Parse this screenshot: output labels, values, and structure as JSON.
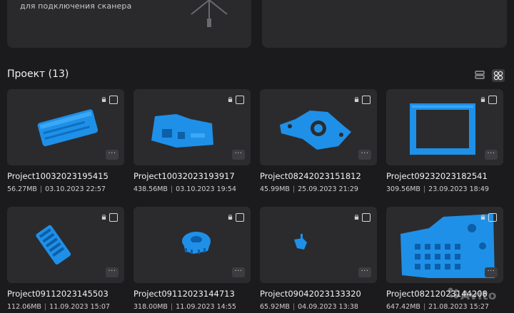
{
  "top": {
    "connect_hint": "для подключения сканера"
  },
  "section": {
    "title": "Проект (13)"
  },
  "view_toggle": {
    "list_icon": "list-view-icon",
    "grid_icon": "grid-view-icon"
  },
  "accent_color": "#1e90e8",
  "projects": [
    {
      "name": "Project10032023195415",
      "size": "56.27MB",
      "date": "03.10.2023 22:57"
    },
    {
      "name": "Project10032023193917",
      "size": "438.56MB",
      "date": "03.10.2023 19:54"
    },
    {
      "name": "Project08242023151812",
      "size": "45.99MB",
      "date": "25.09.2023 21:29"
    },
    {
      "name": "Project09232023182541",
      "size": "309.56MB",
      "date": "23.09.2023 18:49"
    },
    {
      "name": "Project09112023145503",
      "size": "112.06MB",
      "date": "11.09.2023 15:07"
    },
    {
      "name": "Project09112023144713",
      "size": "318.00MB",
      "date": "11.09.2023 14:55"
    },
    {
      "name": "Project09042023133320",
      "size": "65.92MB",
      "date": "04.09.2023 13:38"
    },
    {
      "name": "Project08212023144208",
      "size": "647.42MB",
      "date": "21.08.2023 15:27"
    }
  ],
  "more_label": "···",
  "watermark": "Avito"
}
